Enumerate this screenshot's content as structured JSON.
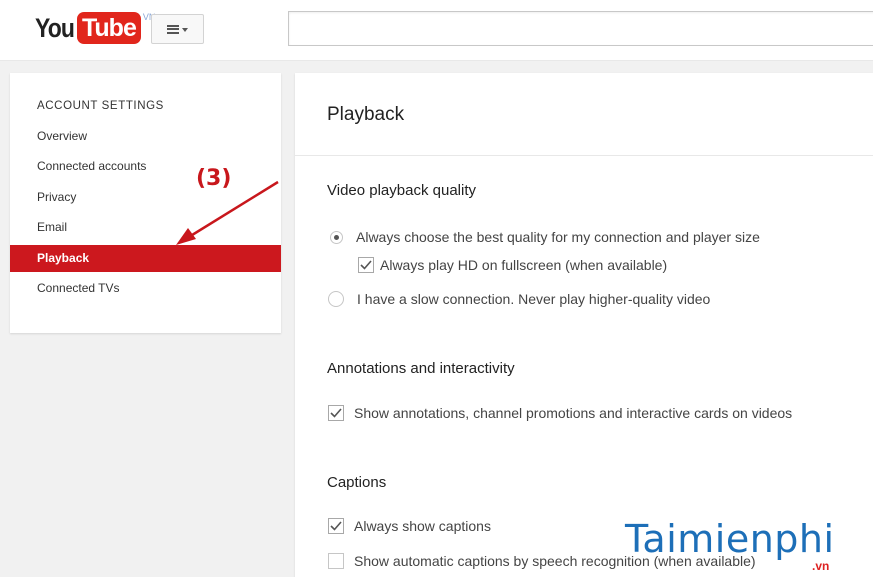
{
  "header": {
    "logo_you": "You",
    "logo_tube": "Tube",
    "logo_country": "VN",
    "guide_icon": "hamburger-menu-icon",
    "search": {
      "value": "",
      "placeholder": ""
    }
  },
  "sidebar": {
    "title": "ACCOUNT SETTINGS",
    "items": [
      {
        "label": "Overview",
        "active": false
      },
      {
        "label": "Connected accounts",
        "active": false
      },
      {
        "label": "Privacy",
        "active": false
      },
      {
        "label": "Email",
        "active": false
      },
      {
        "label": "Playback",
        "active": true
      },
      {
        "label": "Connected TVs",
        "active": false
      }
    ],
    "active_color": "#cc181e"
  },
  "annotation": {
    "label": "(3)",
    "color": "#c8171c"
  },
  "main": {
    "title": "Playback",
    "sections": {
      "quality": {
        "title": "Video playback quality",
        "options": [
          {
            "label": "Always choose the best quality for my connection and player size",
            "type": "radio",
            "selected": true
          },
          {
            "label": "Always play HD on fullscreen (when available)",
            "type": "checkbox",
            "checked": true
          },
          {
            "label": "I have a slow connection. Never play higher-quality video",
            "type": "radio",
            "selected": false
          }
        ]
      },
      "annotations": {
        "title": "Annotations and interactivity",
        "options": [
          {
            "label": "Show annotations, channel promotions and interactive cards on videos",
            "type": "checkbox",
            "checked": true
          }
        ]
      },
      "captions": {
        "title": "Captions",
        "options": [
          {
            "label": "Always show captions",
            "type": "checkbox",
            "checked": true
          },
          {
            "label": "Show automatic captions by speech recognition (when available)",
            "type": "checkbox",
            "checked": false
          }
        ]
      }
    }
  },
  "watermark": {
    "text": "Taimienphi",
    "sub": ".vn",
    "color": "#1d6fb8"
  }
}
